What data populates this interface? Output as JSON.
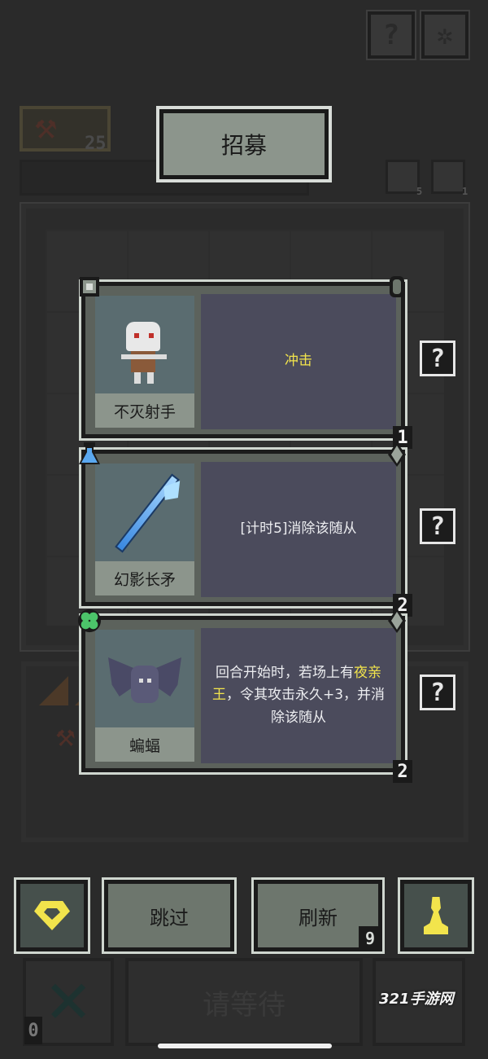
{
  "header": {
    "recruit_label": "招募",
    "weapon_count": "25",
    "help_icon": "question-icon",
    "settings_icon": "gear-icon",
    "mini_counts": [
      "5",
      "1"
    ]
  },
  "cards": [
    {
      "name": "不灭射手",
      "desc_plain": "冲击",
      "desc_parts": [
        {
          "text": "冲击",
          "color": "yellow"
        }
      ],
      "tier": "1",
      "corner_left": "shield-icon",
      "corner_right": "bracket-icon",
      "portrait": "skeleton-archer-sprite"
    },
    {
      "name": "幻影长矛",
      "desc_plain": "[计时5]消除该随从",
      "desc_parts": [
        {
          "text": "[计时5]消除该随从",
          "color": "white"
        }
      ],
      "tier": "2",
      "corner_left": "potion-icon",
      "corner_right": "spike-icon",
      "portrait": "spear-sprite"
    },
    {
      "name": "蝙蝠",
      "desc_plain": "回合开始时，若场上有夜亲王，令其攻击永久+3，并消除该随从",
      "desc_parts": [
        {
          "text": "回合开始时，若场上有",
          "color": "white"
        },
        {
          "text": "夜亲王",
          "color": "yellow"
        },
        {
          "text": "，令其攻击永久+3，并消除该随从",
          "color": "white"
        }
      ],
      "tier": "2",
      "corner_left": "clover-icon",
      "corner_right": "spike-icon",
      "portrait": "bat-sprite"
    }
  ],
  "controls": {
    "skip_label": "跳过",
    "refresh_label": "刷新",
    "refresh_count": "9",
    "wait_label": "请等待",
    "zero_count": "0"
  },
  "watermark": "321手游网",
  "colors": {
    "accent_yellow": "#f2e44c",
    "card_desc_bg": "#4b4b5c",
    "button_bg": "#6d766d"
  }
}
